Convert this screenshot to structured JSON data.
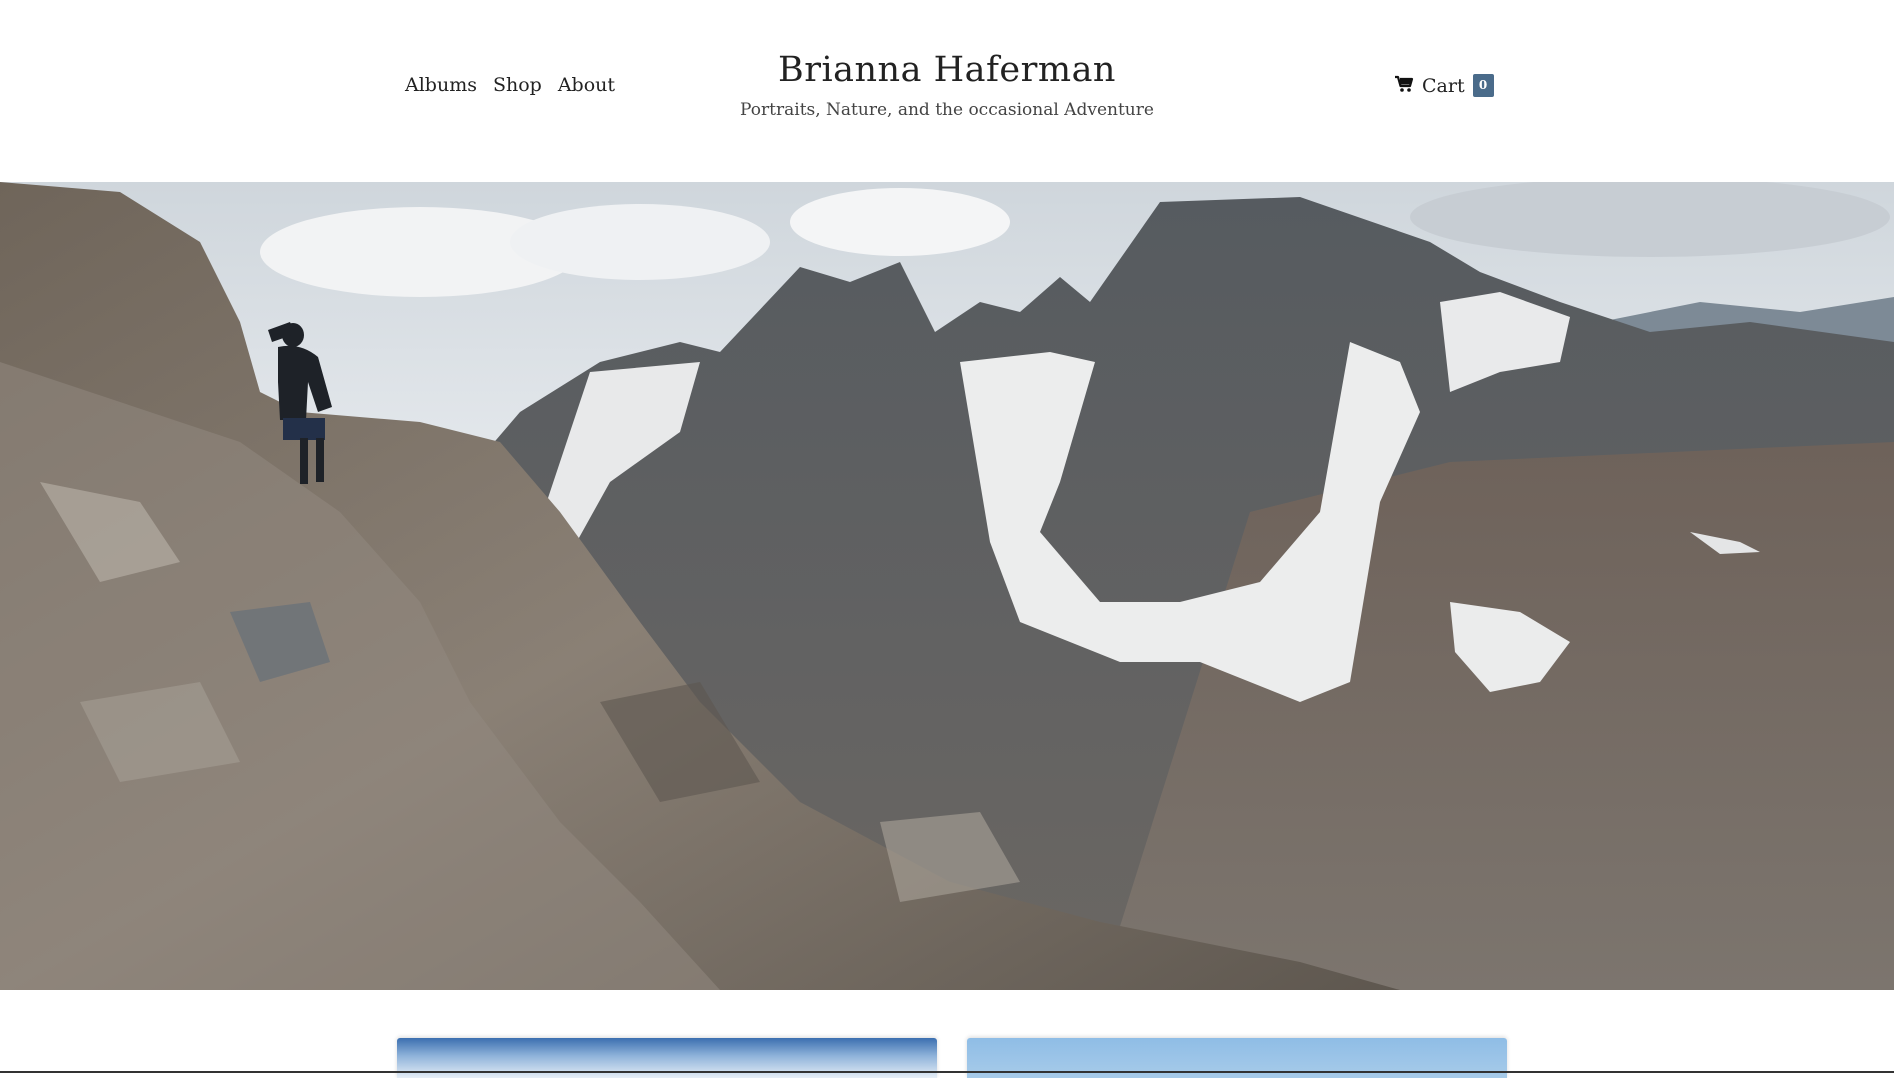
{
  "nav": {
    "items": [
      "Albums",
      "Shop",
      "About"
    ]
  },
  "brand": {
    "title": "Brianna Haferman",
    "tagline": "Portraits, Nature, and the occasional Adventure"
  },
  "cart": {
    "label": "Cart",
    "count": "0",
    "icon": "shopping-cart-icon",
    "badge_color": "#4a6b8a"
  },
  "hero": {
    "description_icon": "mountain-landscape-photo"
  }
}
